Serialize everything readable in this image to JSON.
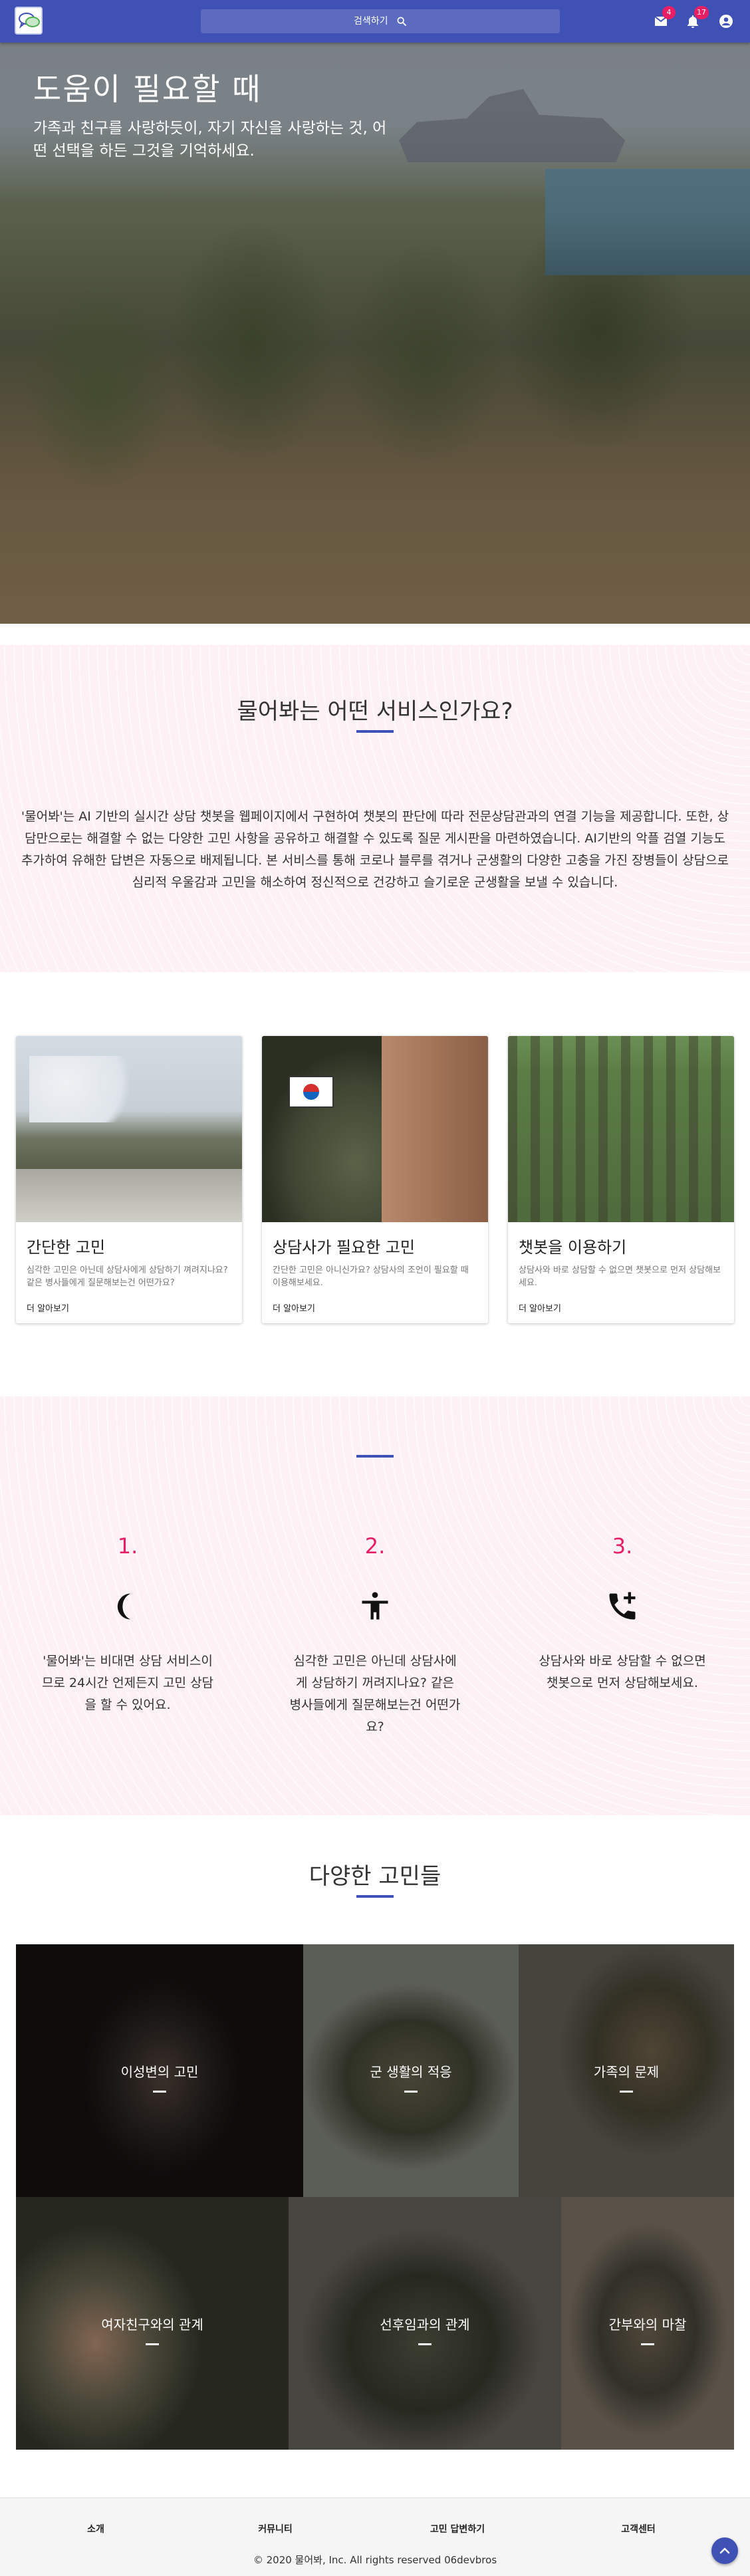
{
  "header": {
    "search_label": "검색하기",
    "mail_badge": "4",
    "notification_badge": "17"
  },
  "hero": {
    "title": "도움이 필요할 때",
    "subtitle": "가족과 친구를 사랑하듯이, 자기 자신을 사랑하는 것, 어떤 선택을 하든 그것을 기억하세요."
  },
  "about": {
    "title": "물어봐는 어떤 서비스인가요?",
    "description": "'물어봐'는 AI 기반의 실시간 상담 챗봇을 웹페이지에서 구현하여 챗봇의 판단에 따라 전문상담관과의 연결 기능을 제공합니다. 또한, 상담만으로는 해결할 수 없는 다양한 고민 사항을 공유하고 해결할 수 있도록 질문 게시판을 마련하였습니다. AI기반의 악플 검열 기능도 추가하여 유해한 답변은 자동으로 배제됩니다. 본 서비스를 통해 코로나 블루를 겪거나 군생활의 다양한 고충을 가진 장병들이 상담으로 심리적 우울감과 고민을 해소하여 정신적으로 건강하고 슬기로운 군생활을 보낼 수 있습니다."
  },
  "cards": [
    {
      "title": "간단한 고민",
      "description": "심각한 고민은 아닌데 상담사에게 상담하기 껴려지나요? 같은 병사들에게 질문해보는건 어떤가요?",
      "more": "더 알아보기"
    },
    {
      "title": "상담사가 필요한 고민",
      "description": "간단한 고민은 아니신가요? 상담사의 조언이 필요할 때 이용해보세요.",
      "more": "더 알아보기"
    },
    {
      "title": "챗봇을 이용하기",
      "description": "상담사와 바로 상담할 수 없으면 챗봇으로 먼저 상담해보세요.",
      "more": "더 알아보기"
    }
  ],
  "steps": [
    {
      "number": "1.",
      "icon": "moon-icon",
      "text": "'물어봐'는 비대면 상담 서비스이므로 24시간 언제든지 고민 상담을 할 수 있어요."
    },
    {
      "number": "2.",
      "icon": "person-icon",
      "text": "심각한 고민은 아닌데 상담사에게 상담하기 꺼려지나요? 같은 병사들에게 질문해보는건 어떤가요?"
    },
    {
      "number": "3.",
      "icon": "phone-add-icon",
      "text": "상담사와 바로 상담할 수 없으면 챗봇으로 먼저 상담해보세요."
    }
  ],
  "concerns": {
    "title": "다양한 고민들",
    "items": [
      {
        "label": "이성변의 고민"
      },
      {
        "label": "군 생활의 적응"
      },
      {
        "label": "가족의 문제"
      },
      {
        "label": "여자친구와의 관계"
      },
      {
        "label": "선후임과의 관계"
      },
      {
        "label": "간부와의 마찰"
      }
    ]
  },
  "footer": {
    "links": [
      "소개",
      "커뮤니티",
      "고민 답변하기",
      "고객센터"
    ],
    "copyright": "© 2020 물어봐, Inc. All rights reserved 06devbros"
  },
  "colors": {
    "primary": "#3f51b5",
    "accent": "#e91e63",
    "section_pink": "#fdf1f5"
  }
}
